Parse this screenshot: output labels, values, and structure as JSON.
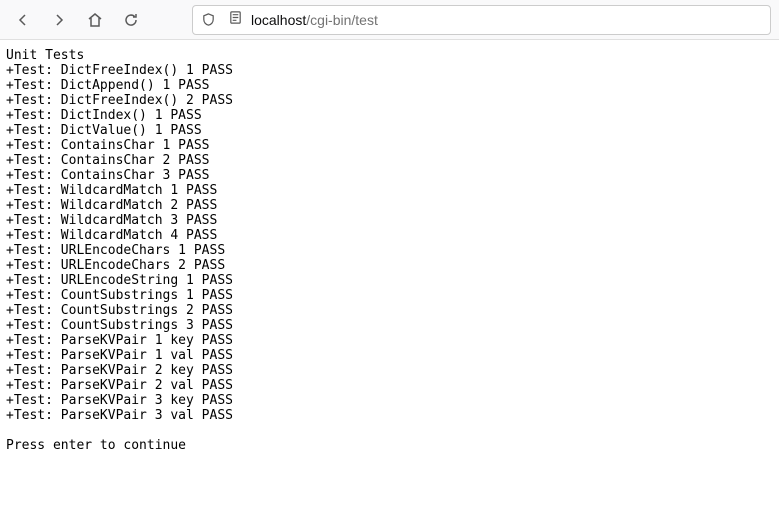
{
  "url": {
    "host": "localhost",
    "path": "/cgi-bin/test"
  },
  "page": {
    "title": "Unit Tests",
    "tests": [
      "+Test: DictFreeIndex() 1 PASS",
      "+Test: DictAppend() 1 PASS",
      "+Test: DictFreeIndex() 2 PASS",
      "+Test: DictIndex() 1 PASS",
      "+Test: DictValue() 1 PASS",
      "+Test: ContainsChar 1 PASS",
      "+Test: ContainsChar 2 PASS",
      "+Test: ContainsChar 3 PASS",
      "+Test: WildcardMatch 1 PASS",
      "+Test: WildcardMatch 2 PASS",
      "+Test: WildcardMatch 3 PASS",
      "+Test: WildcardMatch 4 PASS",
      "+Test: URLEncodeChars 1 PASS",
      "+Test: URLEncodeChars 2 PASS",
      "+Test: URLEncodeString 1 PASS",
      "+Test: CountSubstrings 1 PASS",
      "+Test: CountSubstrings 2 PASS",
      "+Test: CountSubstrings 3 PASS",
      "+Test: ParseKVPair 1 key PASS",
      "+Test: ParseKVPair 1 val PASS",
      "+Test: ParseKVPair 2 key PASS",
      "+Test: ParseKVPair 2 val PASS",
      "+Test: ParseKVPair 3 key PASS",
      "+Test: ParseKVPair 3 val PASS"
    ],
    "footer": "Press enter to continue"
  }
}
